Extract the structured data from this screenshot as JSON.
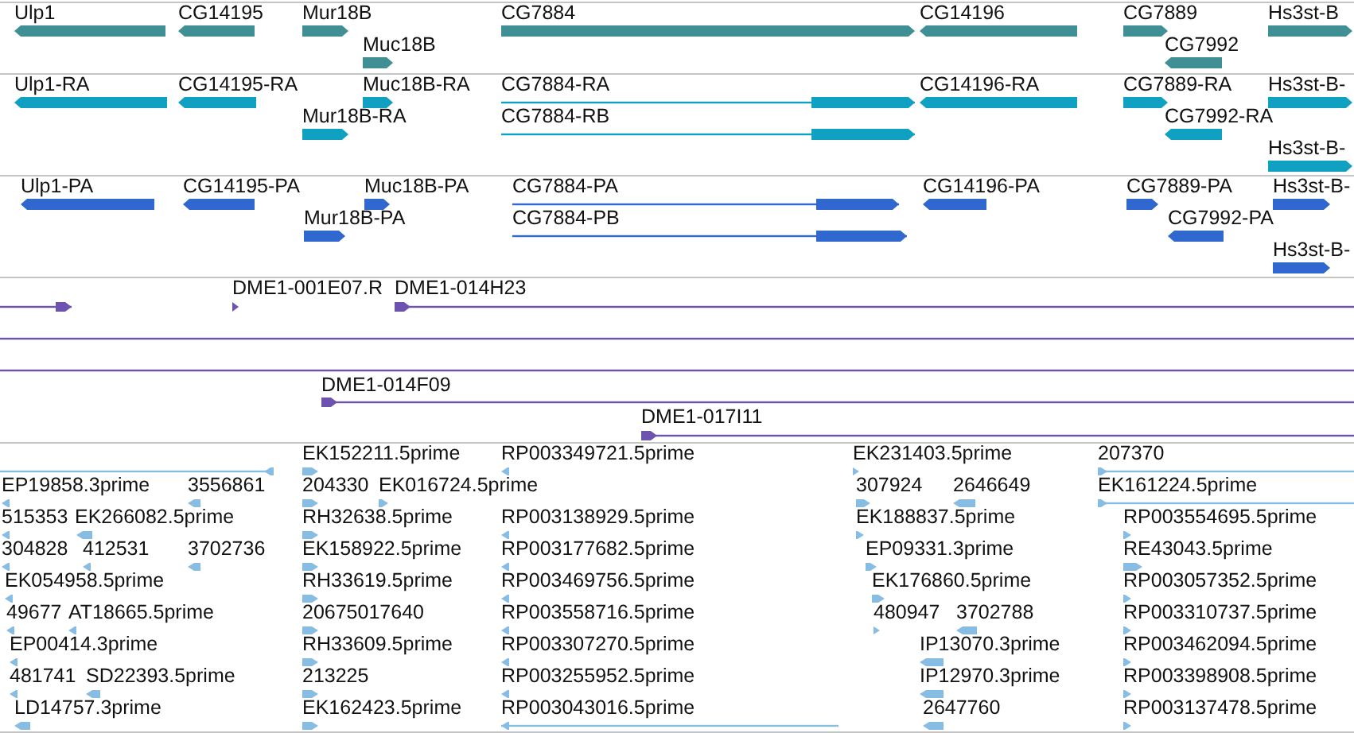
{
  "tracks": [
    {
      "kind": "genes",
      "features": [
        {
          "label": "Ulp1",
          "reverse": true
        },
        {
          "label": "CG14195",
          "reverse": true
        },
        {
          "label": "Mur18B",
          "reverse": false
        },
        {
          "label": "CG7884",
          "reverse": false
        },
        {
          "label": "CG14196",
          "reverse": true
        },
        {
          "label": "CG7889",
          "reverse": false
        },
        {
          "label": "Hs3st-B",
          "reverse": false
        },
        {
          "label": "Muc18B",
          "reverse": false
        },
        {
          "label": "CG7992",
          "reverse": true
        }
      ]
    },
    {
      "kind": "transcripts",
      "features": [
        {
          "label": "Ulp1-RA",
          "reverse": true
        },
        {
          "label": "CG14195-RA",
          "reverse": true
        },
        {
          "label": "Muc18B-RA",
          "reverse": false
        },
        {
          "label": "CG7884-RA",
          "reverse": false
        },
        {
          "label": "CG14196-RA",
          "reverse": true
        },
        {
          "label": "CG7889-RA",
          "reverse": false
        },
        {
          "label": "Hs3st-B-",
          "reverse": false
        },
        {
          "label": "Mur18B-RA",
          "reverse": false
        },
        {
          "label": "CG7884-RB",
          "reverse": false
        },
        {
          "label": "CG7992-RA",
          "reverse": true
        },
        {
          "label": "Hs3st-B-",
          "reverse": false
        }
      ]
    },
    {
      "kind": "proteins",
      "features": [
        {
          "label": "Ulp1-PA",
          "reverse": true
        },
        {
          "label": "CG14195-PA",
          "reverse": true
        },
        {
          "label": "Muc18B-PA",
          "reverse": false
        },
        {
          "label": "CG7884-PA",
          "reverse": false
        },
        {
          "label": "CG14196-PA",
          "reverse": true
        },
        {
          "label": "CG7889-PA",
          "reverse": false
        },
        {
          "label": "Hs3st-B-",
          "reverse": false
        },
        {
          "label": "Mur18B-PA",
          "reverse": false
        },
        {
          "label": "CG7884-PB",
          "reverse": false
        },
        {
          "label": "CG7992-PA",
          "reverse": true
        },
        {
          "label": "Hs3st-B-",
          "reverse": false
        }
      ]
    },
    {
      "kind": "clones",
      "features": [
        {
          "kind": "arrow",
          "reverse": false
        },
        {
          "kind": "arrow",
          "label": "DME1-001E07.R",
          "reverse": false
        },
        {
          "kind": "arrow",
          "label": "DME1-014H23",
          "reverse": false
        },
        {
          "kind": "line"
        },
        {
          "kind": "line"
        },
        {
          "kind": "arrow",
          "label": "DME1-014F09",
          "reverse": false
        },
        {
          "kind": "arrow",
          "label": "DME1-017I11",
          "reverse": false
        }
      ]
    },
    {
      "kind": "ests",
      "features": [
        {
          "reverse": true
        },
        {
          "label": "EK152211.5prime",
          "reverse": false
        },
        {
          "label": "RP003349721.5prime",
          "reverse": true
        },
        {
          "label": "EK231403.5prime",
          "reverse": false
        },
        {
          "label": "207370",
          "reverse": false
        },
        {
          "label": "EP19858.3prime",
          "reverse": true
        },
        {
          "label": "3556861",
          "reverse": true
        },
        {
          "label": "204330",
          "reverse": false
        },
        {
          "label": "EK016724.5prime",
          "reverse": false
        },
        {
          "label": "307924",
          "reverse": false
        },
        {
          "label": "2646649",
          "reverse": true
        },
        {
          "label": "EK161224.5prime",
          "reverse": false
        },
        {
          "label": "515353",
          "reverse": true
        },
        {
          "label": "EK266082.5prime",
          "reverse": true
        },
        {
          "label": "RH32638.5prime",
          "reverse": false
        },
        {
          "label": "RP003138929.5prime",
          "reverse": true
        },
        {
          "label": "EK188837.5prime",
          "reverse": false
        },
        {
          "label": "RP003554695.5prime",
          "reverse": false
        },
        {
          "label": "304828",
          "reverse": true
        },
        {
          "label": "412531",
          "reverse": true
        },
        {
          "label": "3702736",
          "reverse": true
        },
        {
          "label": "EK158922.5prime",
          "reverse": false
        },
        {
          "label": "RP003177682.5prime",
          "reverse": true
        },
        {
          "label": "EP09331.3prime",
          "reverse": false
        },
        {
          "label": "RE43043.5prime",
          "reverse": false
        },
        {
          "label": "EK054958.5prime",
          "reverse": true
        },
        {
          "label": "RH33619.5prime",
          "reverse": false
        },
        {
          "label": "RP003469756.5prime",
          "reverse": true
        },
        {
          "label": "EK176860.5prime",
          "reverse": false
        },
        {
          "label": "RP003057352.5prime",
          "reverse": false
        },
        {
          "label": "49677",
          "reverse": true
        },
        {
          "label": "AT18665.5prime",
          "reverse": true
        },
        {
          "label": "20675017640",
          "reverse": false
        },
        {
          "label": "RP003558716.5prime",
          "reverse": true
        },
        {
          "label": "480947",
          "reverse": false
        },
        {
          "label": "3702788",
          "reverse": true
        },
        {
          "label": "RP003310737.5prime",
          "reverse": false
        },
        {
          "label": "EP00414.3prime",
          "reverse": true
        },
        {
          "label": "RH33609.5prime",
          "reverse": false
        },
        {
          "label": "RP003307270.5prime",
          "reverse": true
        },
        {
          "label": "IP13070.3prime",
          "reverse": true
        },
        {
          "label": "RP003462094.5prime",
          "reverse": false
        },
        {
          "label": "481741",
          "reverse": true
        },
        {
          "label": "SD22393.5prime",
          "reverse": true
        },
        {
          "label": "213225",
          "reverse": false
        },
        {
          "label": "RP003255952.5prime",
          "reverse": true
        },
        {
          "label": "IP12970.3prime",
          "reverse": true
        },
        {
          "label": "RP003398908.5prime",
          "reverse": false
        },
        {
          "label": "LD14757.3prime",
          "reverse": true
        },
        {
          "label": "EK162423.5prime",
          "reverse": false
        },
        {
          "label": "RP003043016.5prime",
          "reverse": true
        },
        {
          "label": "2647760",
          "reverse": true
        },
        {
          "label": "RP003137478.5prime",
          "reverse": false
        }
      ]
    }
  ]
}
